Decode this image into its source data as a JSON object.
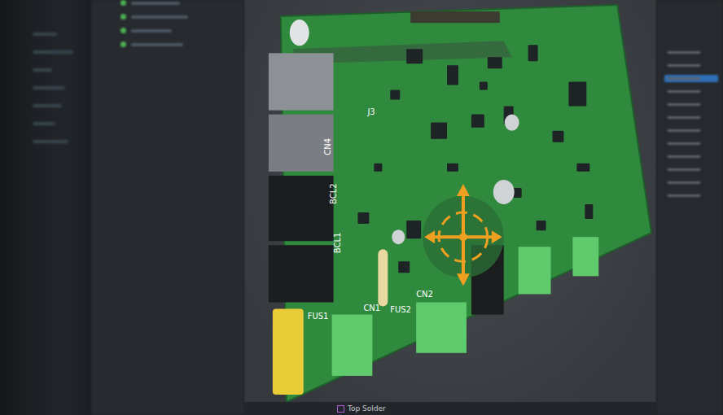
{
  "viewport": {
    "board_labels": [
      {
        "text": "J3"
      },
      {
        "text": "CN4"
      },
      {
        "text": "BCL2"
      },
      {
        "text": "BCL1"
      },
      {
        "text": "FUS1"
      },
      {
        "text": "CN1"
      },
      {
        "text": "FUS2"
      },
      {
        "text": "CN2"
      }
    ]
  },
  "layer_bar": {
    "tabs": [
      {
        "label": "Top Solder",
        "color": "#b05ad8"
      }
    ]
  },
  "properties_panel": {
    "rows": [
      {
        "selected": false
      },
      {
        "selected": false
      },
      {
        "selected": true
      },
      {
        "selected": false
      },
      {
        "selected": false
      },
      {
        "selected": false
      },
      {
        "selected": false
      },
      {
        "selected": false
      },
      {
        "selected": false
      },
      {
        "selected": false
      },
      {
        "selected": false
      },
      {
        "selected": false
      }
    ]
  }
}
